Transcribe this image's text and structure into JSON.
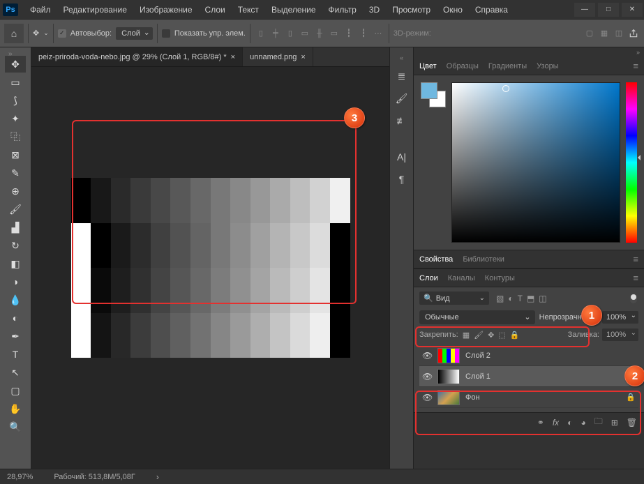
{
  "menu": [
    "Файл",
    "Редактирование",
    "Изображение",
    "Слои",
    "Текст",
    "Выделение",
    "Фильтр",
    "3D",
    "Просмотр",
    "Окно",
    "Справка"
  ],
  "options": {
    "autoselect_label": "Автовыбор:",
    "autoselect_value": "Слой",
    "show_controls": "Показать упр. элем.",
    "mode_3d": "3D-режим:"
  },
  "tabs": [
    {
      "title": "peiz-priroda-voda-nebo.jpg @ 29% (Слой 1, RGB/8#) *",
      "active": true
    },
    {
      "title": "unnamed.png",
      "active": false
    }
  ],
  "right_panel": {
    "color_tabs": [
      "Цвет",
      "Образцы",
      "Градиенты",
      "Узоры"
    ],
    "prop_tabs": [
      "Свойства",
      "Библиотеки"
    ],
    "layer_tabs": [
      "Слои",
      "Каналы",
      "Контуры"
    ],
    "view_label": "Вид",
    "blend_mode": "Обычные",
    "opacity_label": "Непрозрачность:",
    "opacity_value": "100%",
    "lock_label": "Закрепить:",
    "fill_label": "Заливка:",
    "fill_value": "100%",
    "layers": [
      {
        "name": "Слой 2",
        "visible": true,
        "selected": false,
        "thumb": "color",
        "locked": false
      },
      {
        "name": "Слой 1",
        "visible": true,
        "selected": true,
        "thumb": "gradient",
        "locked": false
      },
      {
        "name": "Фон",
        "visible": true,
        "selected": false,
        "thumb": "photo",
        "locked": true
      }
    ]
  },
  "status": {
    "zoom": "28,97%",
    "doc_info": "Рабочий: 513,8М/5,08Г"
  },
  "callouts": {
    "c1": "1",
    "c2": "2",
    "c3": "3"
  },
  "chart_data": {
    "type": "table",
    "note": "grayscale gradient bands on canvas",
    "rows": [
      [
        0,
        24,
        42,
        58,
        72,
        88,
        104,
        120,
        136,
        152,
        170,
        190,
        210,
        240
      ],
      [
        255,
        0,
        26,
        44,
        64,
        82,
        100,
        120,
        140,
        160,
        180,
        200,
        220,
        0
      ],
      [
        255,
        10,
        30,
        48,
        68,
        86,
        104,
        124,
        144,
        164,
        186,
        206,
        228,
        0
      ],
      [
        255,
        20,
        40,
        60,
        78,
        96,
        114,
        134,
        154,
        174,
        196,
        218,
        238,
        0
      ]
    ]
  }
}
